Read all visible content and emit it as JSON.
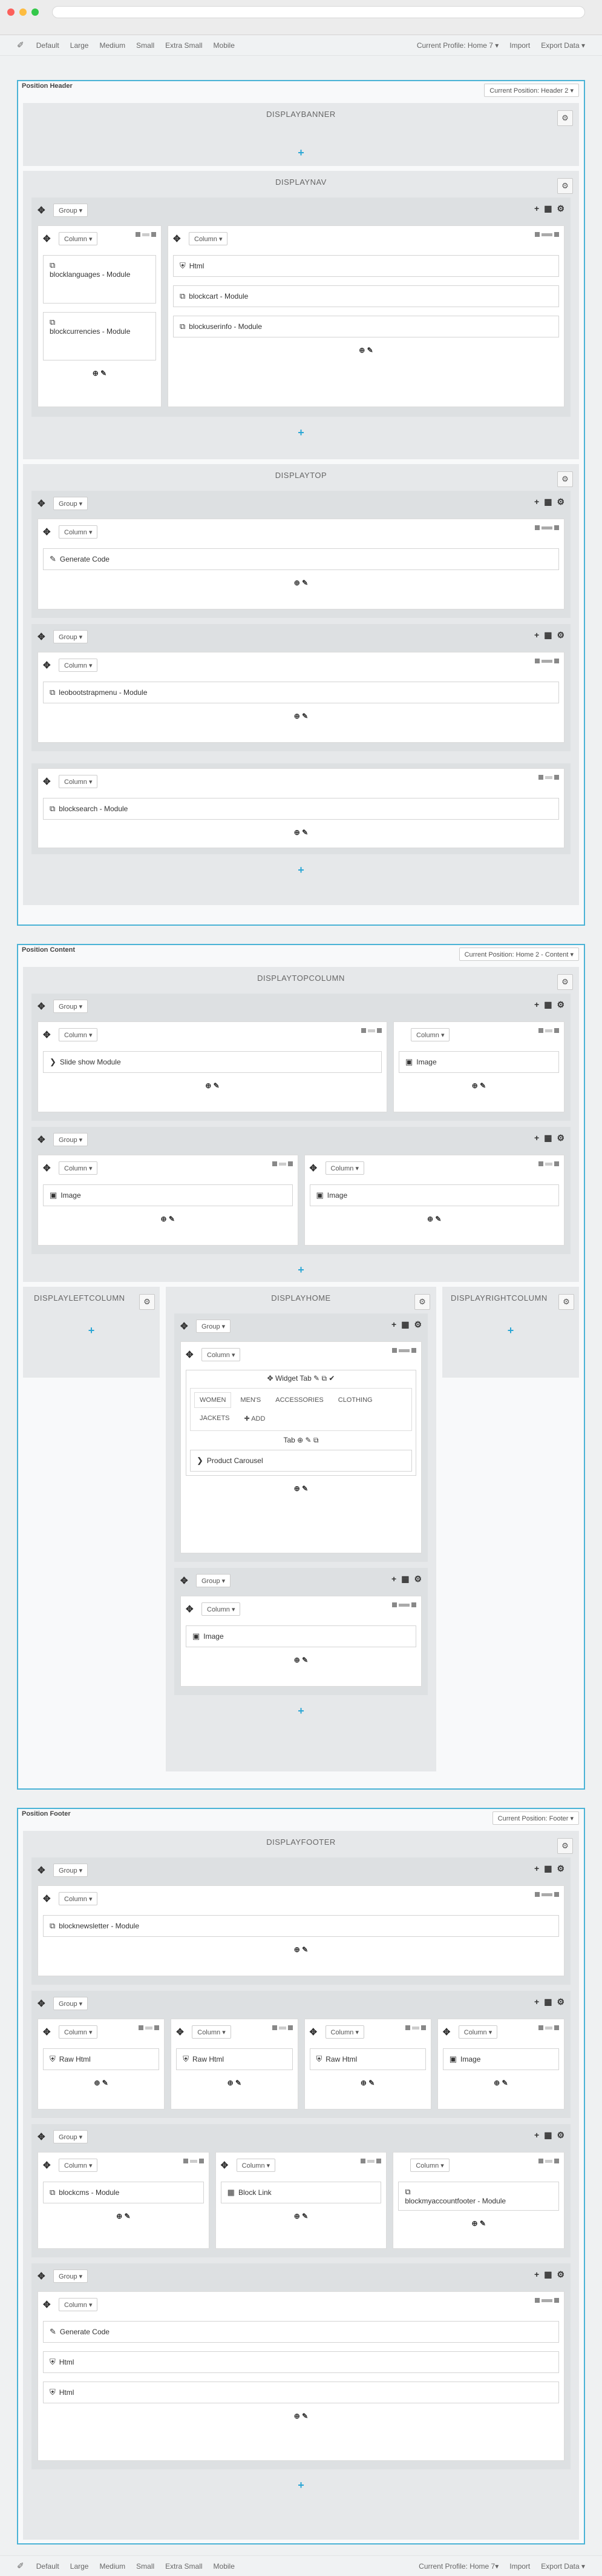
{
  "topbar": {
    "items": [
      "Default",
      "Large",
      "Medium",
      "Small",
      "Extra Small",
      "Mobile"
    ],
    "profile": "Current Profile: Home 7 ▾",
    "import": "Import",
    "export": "Export Data ▾"
  },
  "bottombar": {
    "items": [
      "Default",
      "Large",
      "Medium",
      "Small",
      "Extra Small",
      "Mobile"
    ],
    "profile": "Current Profile: Home 7▾",
    "import": "Import",
    "export": "Export Data ▾"
  },
  "header": {
    "title": "Position Header",
    "position": "Current Position: Header 2 ▾"
  },
  "content": {
    "title": "Position Content",
    "position": "Current Position: Home 2 - Content ▾"
  },
  "footer": {
    "title": "Position Footer",
    "position": "Current Position: Footer ▾"
  },
  "labels": {
    "group": "Group ▾",
    "column": "Column ▾",
    "plus": "+"
  },
  "hooks": {
    "banner": "DISPLAYBANNER",
    "nav": "DISPLAYNAV",
    "top": "DISPLAYTOP",
    "topcolumn": "DISPLAYTOPCOLUMN",
    "left": "DISPLAYLEFTCOLUMN",
    "home": "DISPLAYHOME",
    "right": "DISPLAYRIGHTCOLUMN",
    "footer": "DISPLAYFOOTER"
  },
  "widgets": {
    "blocklanguages": "blocklanguages - Module",
    "blockcurrencies": "blockcurrencies - Module",
    "html": "Html",
    "blockcart": "blockcart - Module",
    "blockuserinfo": "blockuserinfo - Module",
    "generate": "Generate Code",
    "leobootstrapmenu": "leobootstrapmenu - Module",
    "blocksearch": "blocksearch - Module",
    "slideshow": "Slide show Module",
    "image": "Image",
    "widgettab": "Widget Tab",
    "addtab": "ADD",
    "tab": "Tab",
    "carousel": "Product Carousel",
    "newsletter": "blocknewsletter - Module",
    "rawhtml": "Raw Html",
    "blockcms": "blockcms - Module",
    "blocklink": "Block Link",
    "myaccount": "blockmyaccountfooter - Module"
  },
  "tabs": [
    "WOMEN",
    "MEN'S",
    "ACCESSORIES",
    "CLOTHING",
    "JACKETS"
  ],
  "icons": {
    "gear": "⚙",
    "move": "✥",
    "grid": "▦",
    "module": "⧉",
    "html5": "⛨",
    "image": "▣",
    "code": "✎",
    "arrow": "❯"
  }
}
